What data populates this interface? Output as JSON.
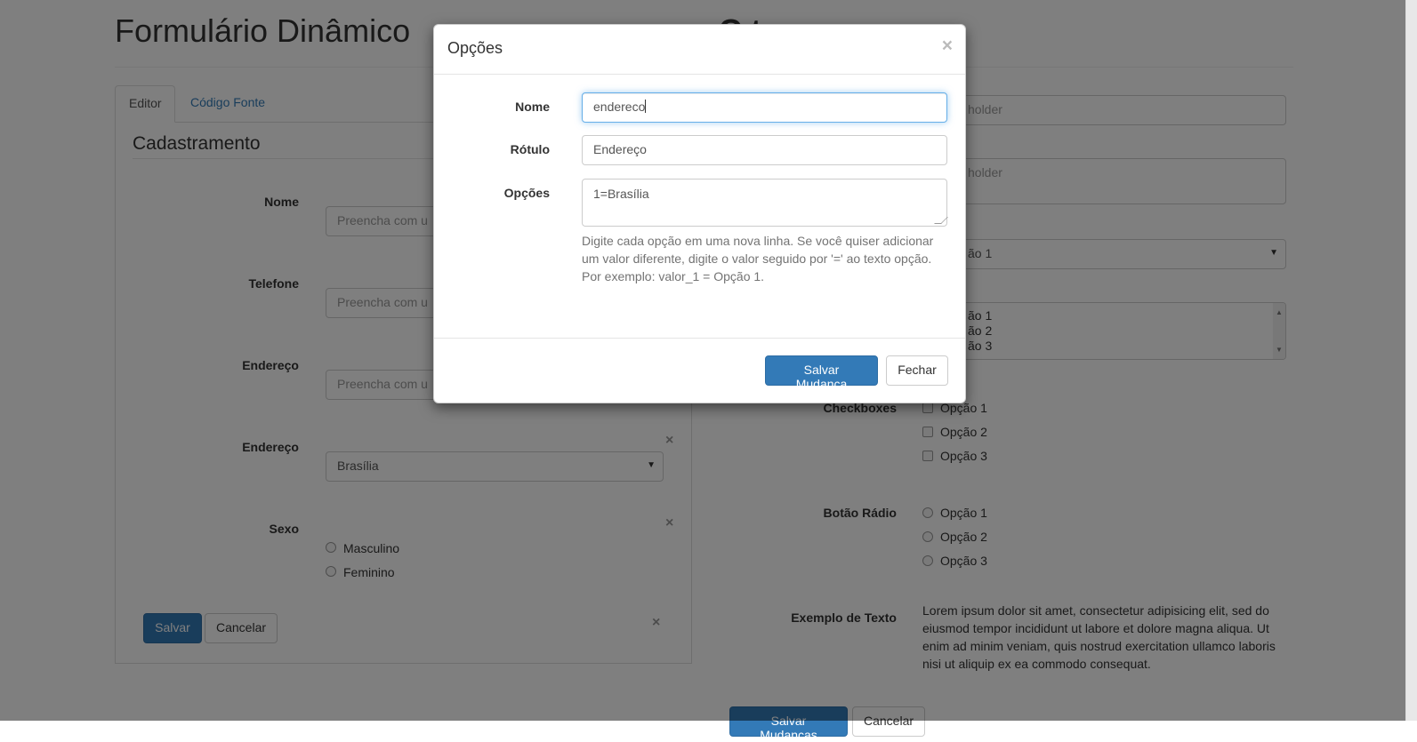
{
  "page": {
    "title": "Formulário Dinâmico",
    "title_right_partial": "C          t",
    "tabs": [
      {
        "label": "Editor"
      },
      {
        "label": "Código Fonte"
      }
    ],
    "form_legend": "Cadastramento",
    "fields": [
      {
        "label": "Nome",
        "placeholder": "Preencha com u"
      },
      {
        "label": "Telefone",
        "placeholder": "Preencha com u"
      },
      {
        "label": "Endereço",
        "placeholder": "Preencha com u"
      },
      {
        "label": "Endereço",
        "selected": "Brasília"
      },
      {
        "label": "Sexo",
        "options": [
          "Masculino",
          "Feminino"
        ]
      }
    ],
    "save_button": "Salvar",
    "cancel_button": "Cancelar",
    "remove_symbol": "×"
  },
  "preview": {
    "text_placeholder": "holder",
    "textarea_placeholder": "holder",
    "select_value": "ão 1",
    "listbox_options": [
      "ão 1",
      "ão 2",
      "ão 3"
    ],
    "checkboxes_label": "Checkboxes",
    "checkbox_options": [
      "Opção 1",
      "Opção 2",
      "Opção 3"
    ],
    "radio_label": "Botão Rádio",
    "radio_options": [
      "Opção 1",
      "Opção 2",
      "Opção 3"
    ],
    "text_example_label": "Exemplo de Texto",
    "lorem": "Lorem ipsum dolor sit amet, consectetur adipisicing elit, sed do eiusmod tempor incididunt ut labore et dolore magna aliqua. Ut enim ad minim veniam, quis nostrud exercitation ullamco laboris nisi ut aliquip ex ea commodo consequat.",
    "save_changes_button": "Salvar Mudanças",
    "cancel_button": "Cancelar"
  },
  "modal": {
    "title": "Opções",
    "close_symbol": "×",
    "name_label": "Nome",
    "name_value": "endereco",
    "label_label": "Rótulo",
    "label_value": "Endereço",
    "options_label": "Opções",
    "options_value": "1=Brasília",
    "help_text": "Digite cada opção em uma nova linha. Se você quiser adicionar um valor diferente, digite o valor seguido por '=' ao texto opção. Por exemplo: valor_1 = Opção 1.",
    "save_button": "Salvar Mudança",
    "close_button": "Fechar"
  },
  "colors": {
    "primary": "#337ab7",
    "link": "#337ab7",
    "backdrop": "rgba(0,0,0,0.5)"
  }
}
